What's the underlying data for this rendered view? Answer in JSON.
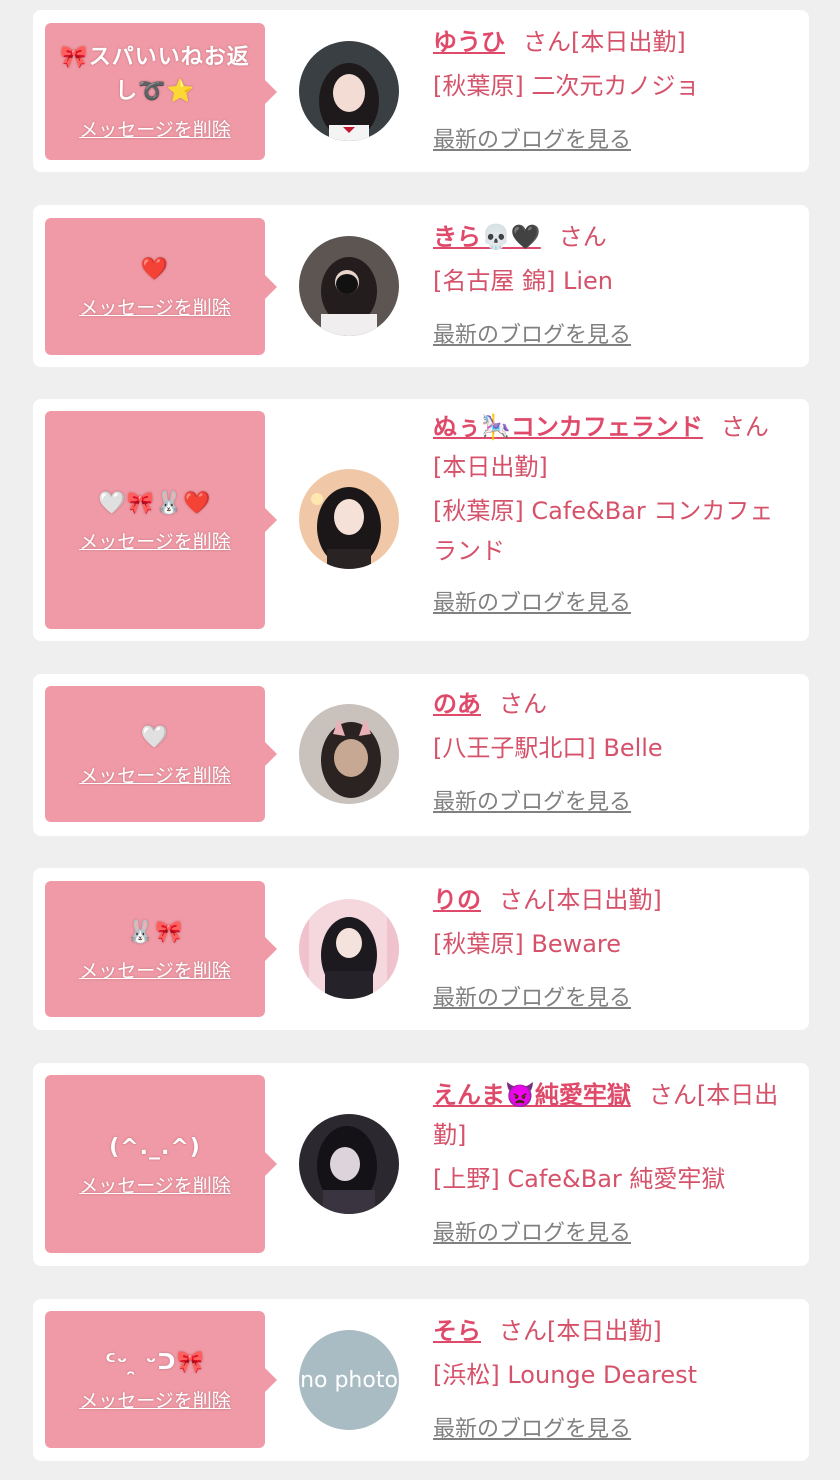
{
  "common": {
    "delete_label": "メッセージを削除",
    "blog_label": "最新のブログを見る",
    "san": "さん"
  },
  "colors": {
    "bubble": "#ef9aa6",
    "text_accent": "#d5526a",
    "link_gray": "#808080",
    "background": "#efefef"
  },
  "entries": [
    {
      "message": "🎀スパいいねお返し➰⭐",
      "name": "ゆうひ",
      "suffix": "[本日出勤]",
      "shop": "[秋葉原] 二次元カノジョ"
    },
    {
      "message": "❤️",
      "name": "きら💀🖤",
      "suffix": "",
      "shop": "[名古屋 錦] Lien"
    },
    {
      "message": "🤍🎀🐰❤️",
      "name": "ぬぅ🎠コンカフェランド",
      "suffix": "[本日出勤]",
      "shop": "[秋葉原] Cafe&Bar コンカフェランド"
    },
    {
      "message": "🤍",
      "name": "のあ",
      "suffix": "",
      "shop": "[八王子駅北口] Belle"
    },
    {
      "message": "🐰🎀",
      "name": "りの",
      "suffix": "[本日出勤]",
      "shop": "[秋葉原] Beware"
    },
    {
      "message": "(^._.^)",
      "name": "えんま👿純愛牢獄",
      "suffix": "[本日出勤]",
      "shop": "[上野] Cafe&Bar 純愛牢獄"
    },
    {
      "message": "ᑦᵕ ̯ ᵕᑐ🎀",
      "name": "そら",
      "suffix": "[本日出勤]",
      "shop": "[浜松] Lounge Dearest",
      "avatar_text": "no photo"
    }
  ]
}
